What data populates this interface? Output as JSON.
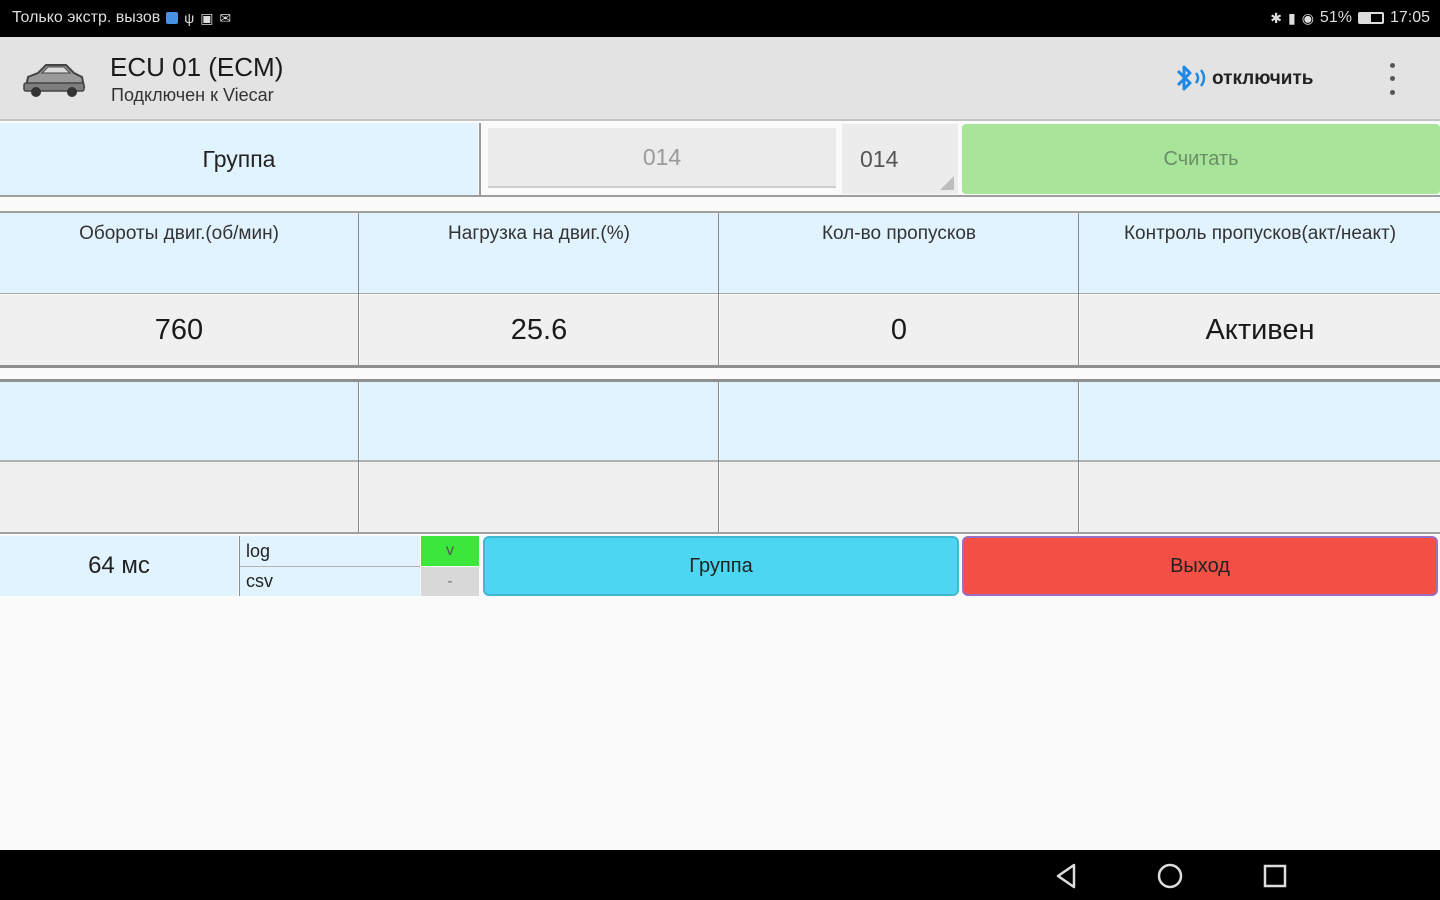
{
  "statusbar": {
    "left_text": "Только экстр. вызов",
    "battery_percent": "51%",
    "battery_level": 0.51,
    "time": "17:05"
  },
  "appbar": {
    "title": "ECU 01 (ECM)",
    "subtitle": "Подключен к Viecar",
    "disconnect_label": "отключить",
    "bluetooth_color": "#1e88e5"
  },
  "controls": {
    "group_label": "Группа",
    "group_input_value": "014",
    "group_spinner_value": "014",
    "read_label": "Считать"
  },
  "measurements": {
    "headers": [
      "Обороты двиг.(об/мин)",
      "Нагрузка на двиг.(%)",
      "Кол-во пропусков",
      "Контроль пропусков(акт/неакт)"
    ],
    "values": [
      "760",
      "25.6",
      "0",
      "Активен"
    ],
    "headers2": [
      "",
      "",
      "",
      ""
    ],
    "values2": [
      "",
      "",
      "",
      ""
    ]
  },
  "bottom": {
    "interval": "64 мс",
    "log_label": "log",
    "csv_label": "csv",
    "log_toggle": "v",
    "csv_toggle": "-",
    "group_button": "Группа",
    "exit_button": "Выход",
    "group_button_color": "#4dd6f2",
    "exit_button_color": "#f44f45",
    "log_toggle_color": "#3ce63c"
  }
}
